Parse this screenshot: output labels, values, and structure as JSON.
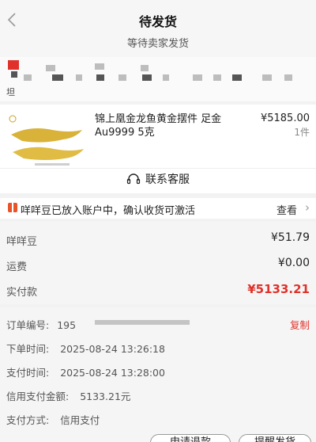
{
  "header": {
    "back_icon": "chevron-left-icon",
    "title": "待发货",
    "subtitle": "等待卖家发货"
  },
  "address": {
    "tail": "坦"
  },
  "product": {
    "name": "锦上凰金龙鱼黄金摆件 足金Au9999 5克",
    "price": "¥5185.00",
    "qty": "1件"
  },
  "service": {
    "label": "联系客服",
    "icon": "headset-icon"
  },
  "promo": {
    "text": "咩咩豆已放入账户中，确认收货可激活",
    "link": "查看",
    "accent": "#e7542a"
  },
  "fees": [
    {
      "label": "咩咩豆",
      "value": "¥51.79"
    },
    {
      "label": "运费",
      "value": "¥0.00"
    },
    {
      "label": "实付款",
      "value": "¥5133.21"
    }
  ],
  "order": {
    "number_label": "订单编号:",
    "number_value": "195",
    "copy": "复制",
    "placed_label": "下单时间:",
    "placed_value": "2025-08-24 13:26:18",
    "paid_label": "支付时间:",
    "paid_value": "2025-08-24 13:28:00",
    "credit_label": "信用支付金额:",
    "credit_value": "5133.21元",
    "method_label": "支付方式:",
    "method_value": "信用支付"
  },
  "actions": {
    "refund": "申请退款",
    "remind": "提醒发货"
  },
  "colors": {
    "accent_red": "#e0322b",
    "background": "#f2f2f2"
  }
}
